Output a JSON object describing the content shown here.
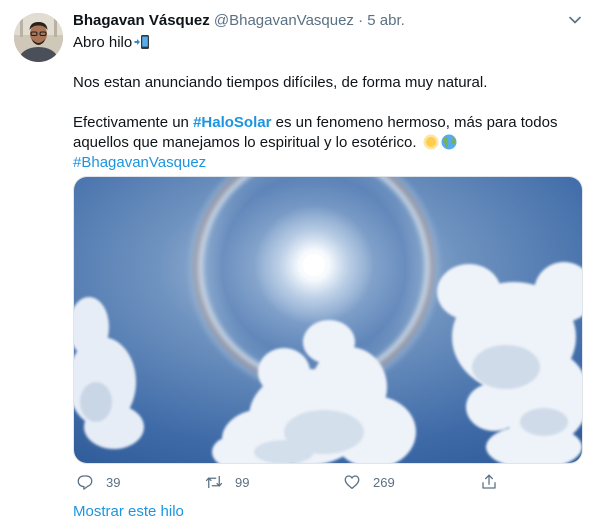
{
  "tweet": {
    "author_name": "Bhagavan Vásquez",
    "handle": "@BhagavanVasquez",
    "separator": "·",
    "date": "5 abr.",
    "intro_text": "Abro hilo",
    "paragraph1": "Nos estan anunciando tiempos difíciles, de forma muy natural.",
    "p2_before": "Efectivamente un ",
    "p2_hashtag": "#HaloSolar",
    "p2_after": " es un fenomeno hermoso, más para todos",
    "p2_line2": "aquellos que manejamos lo espiritual y lo esotérico.",
    "hashtag_author": "#BhagavanVasquez",
    "emoji_icons": [
      "mobile-phone-arrow-icon",
      "sun-icon",
      "globe-americas-icon"
    ],
    "media_description_icon": "solar-halo-photo"
  },
  "actions": {
    "reply_count": "39",
    "retweet_count": "99",
    "like_count": "269"
  },
  "thread_link": "Mostrar este hilo",
  "colors": {
    "link": "#1b95e0",
    "secondary": "#5b7083",
    "text": "#0f1419"
  }
}
